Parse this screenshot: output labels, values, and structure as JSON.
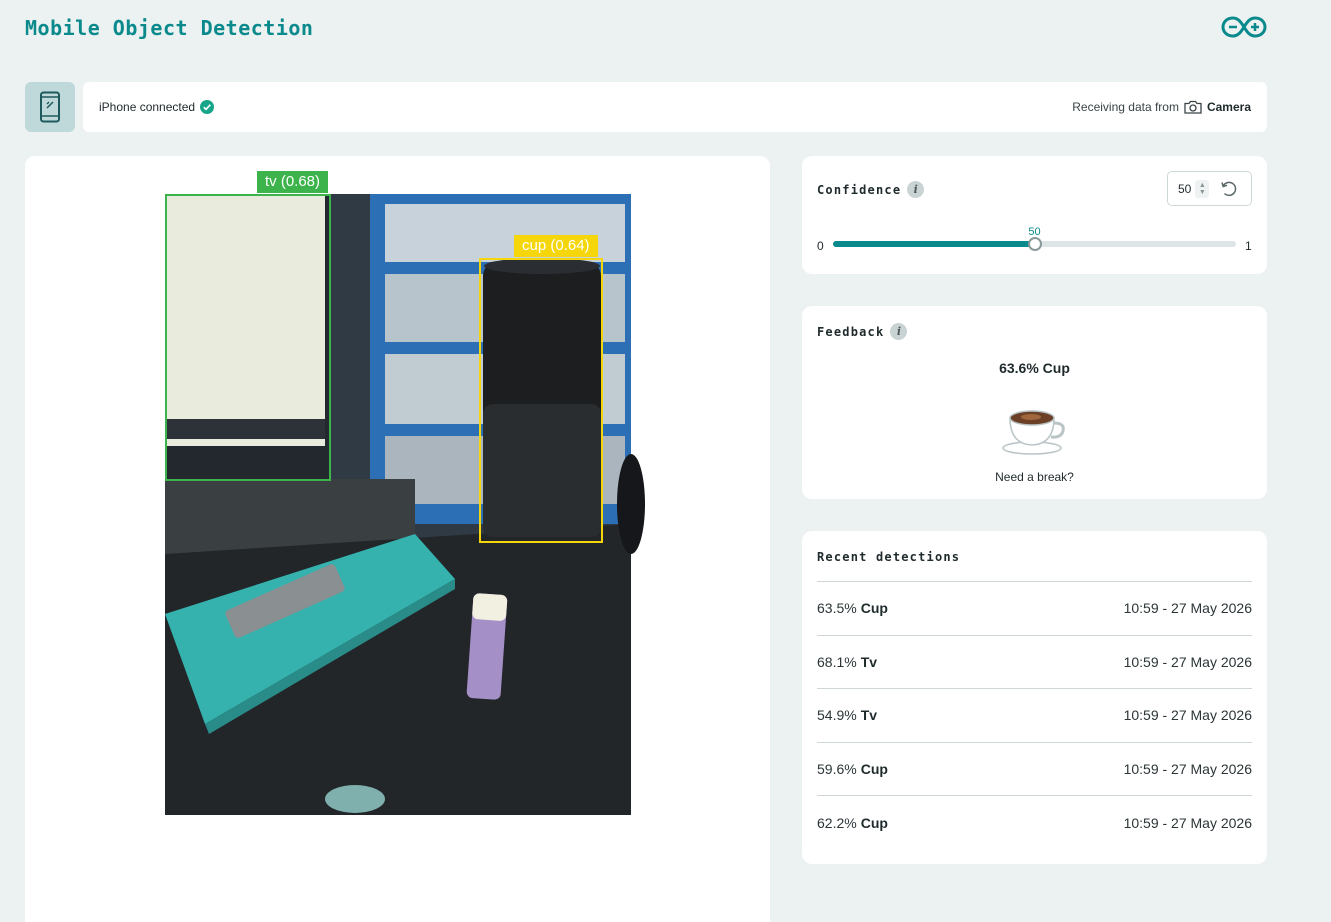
{
  "header": {
    "title": "Mobile Object Detection",
    "logo_icon": "arduino-logo-icon"
  },
  "status": {
    "device_icon": "phone-icon",
    "connected_label": "iPhone connected",
    "check_icon": "check-circle-icon",
    "receiving_label": "Receiving data from",
    "camera_icon": "camera-icon",
    "source": "Camera"
  },
  "video": {
    "detections": [
      {
        "label": "tv (0.68)",
        "color": "#3cb44b"
      },
      {
        "label": "cup (0.64)",
        "color": "#f5d60a"
      }
    ]
  },
  "confidence": {
    "title": "Confidence",
    "value": "50",
    "slider_value": 0.5,
    "slider_value_label": "50",
    "min_label": "0",
    "max_label": "1",
    "accent": "#0a8a8c"
  },
  "feedback": {
    "title": "Feedback",
    "result": "63.6% Cup",
    "icon": "coffee-cup-icon",
    "message": "Need a break?"
  },
  "recent": {
    "title": "Recent detections",
    "items": [
      {
        "pct": "63.5%",
        "label": "Cup",
        "time": "10:59 - 27 May 2026"
      },
      {
        "pct": "68.1%",
        "label": "Tv",
        "time": "10:59 - 27 May 2026"
      },
      {
        "pct": "54.9%",
        "label": "Tv",
        "time": "10:59 - 27 May 2026"
      },
      {
        "pct": "59.6%",
        "label": "Cup",
        "time": "10:59 - 27 May 2026"
      },
      {
        "pct": "62.2%",
        "label": "Cup",
        "time": "10:59 - 27 May 2026"
      }
    ]
  }
}
